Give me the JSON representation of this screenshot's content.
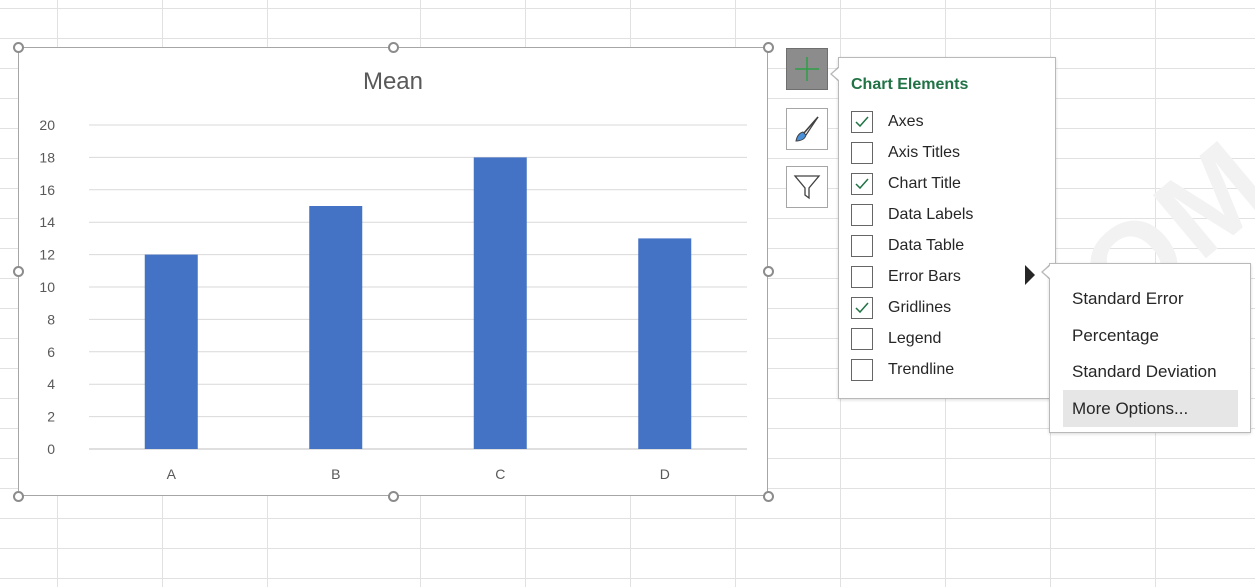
{
  "chart_data": {
    "type": "bar",
    "title": "Mean",
    "categories": [
      "A",
      "B",
      "C",
      "D"
    ],
    "values": [
      12,
      15,
      18,
      13
    ],
    "yticks": [
      "0",
      "2",
      "4",
      "6",
      "8",
      "10",
      "12",
      "14",
      "16",
      "18",
      "20"
    ],
    "ylim": [
      0,
      20
    ],
    "grid": true,
    "bar_color": "#4472c4"
  },
  "side_buttons": {
    "add_icon": "plus-icon",
    "style_icon": "paintbrush-icon",
    "filter_icon": "funnel-icon"
  },
  "chart_elements": {
    "title": "Chart Elements",
    "items": [
      {
        "label": "Axes",
        "checked": true
      },
      {
        "label": "Axis Titles",
        "checked": false
      },
      {
        "label": "Chart Title",
        "checked": true
      },
      {
        "label": "Data Labels",
        "checked": false
      },
      {
        "label": "Data Table",
        "checked": false
      },
      {
        "label": "Error Bars",
        "checked": false
      },
      {
        "label": "Gridlines",
        "checked": true
      },
      {
        "label": "Legend",
        "checked": false
      },
      {
        "label": "Trendline",
        "checked": false
      }
    ]
  },
  "error_bars_menu": {
    "items": [
      "Standard Error",
      "Percentage",
      "Standard Deviation",
      "More Options..."
    ],
    "highlighted": "More Options..."
  },
  "watermark": "COM",
  "colors": {
    "accent_green": "#217346",
    "bar": "#4472c4",
    "check": "#217346"
  }
}
